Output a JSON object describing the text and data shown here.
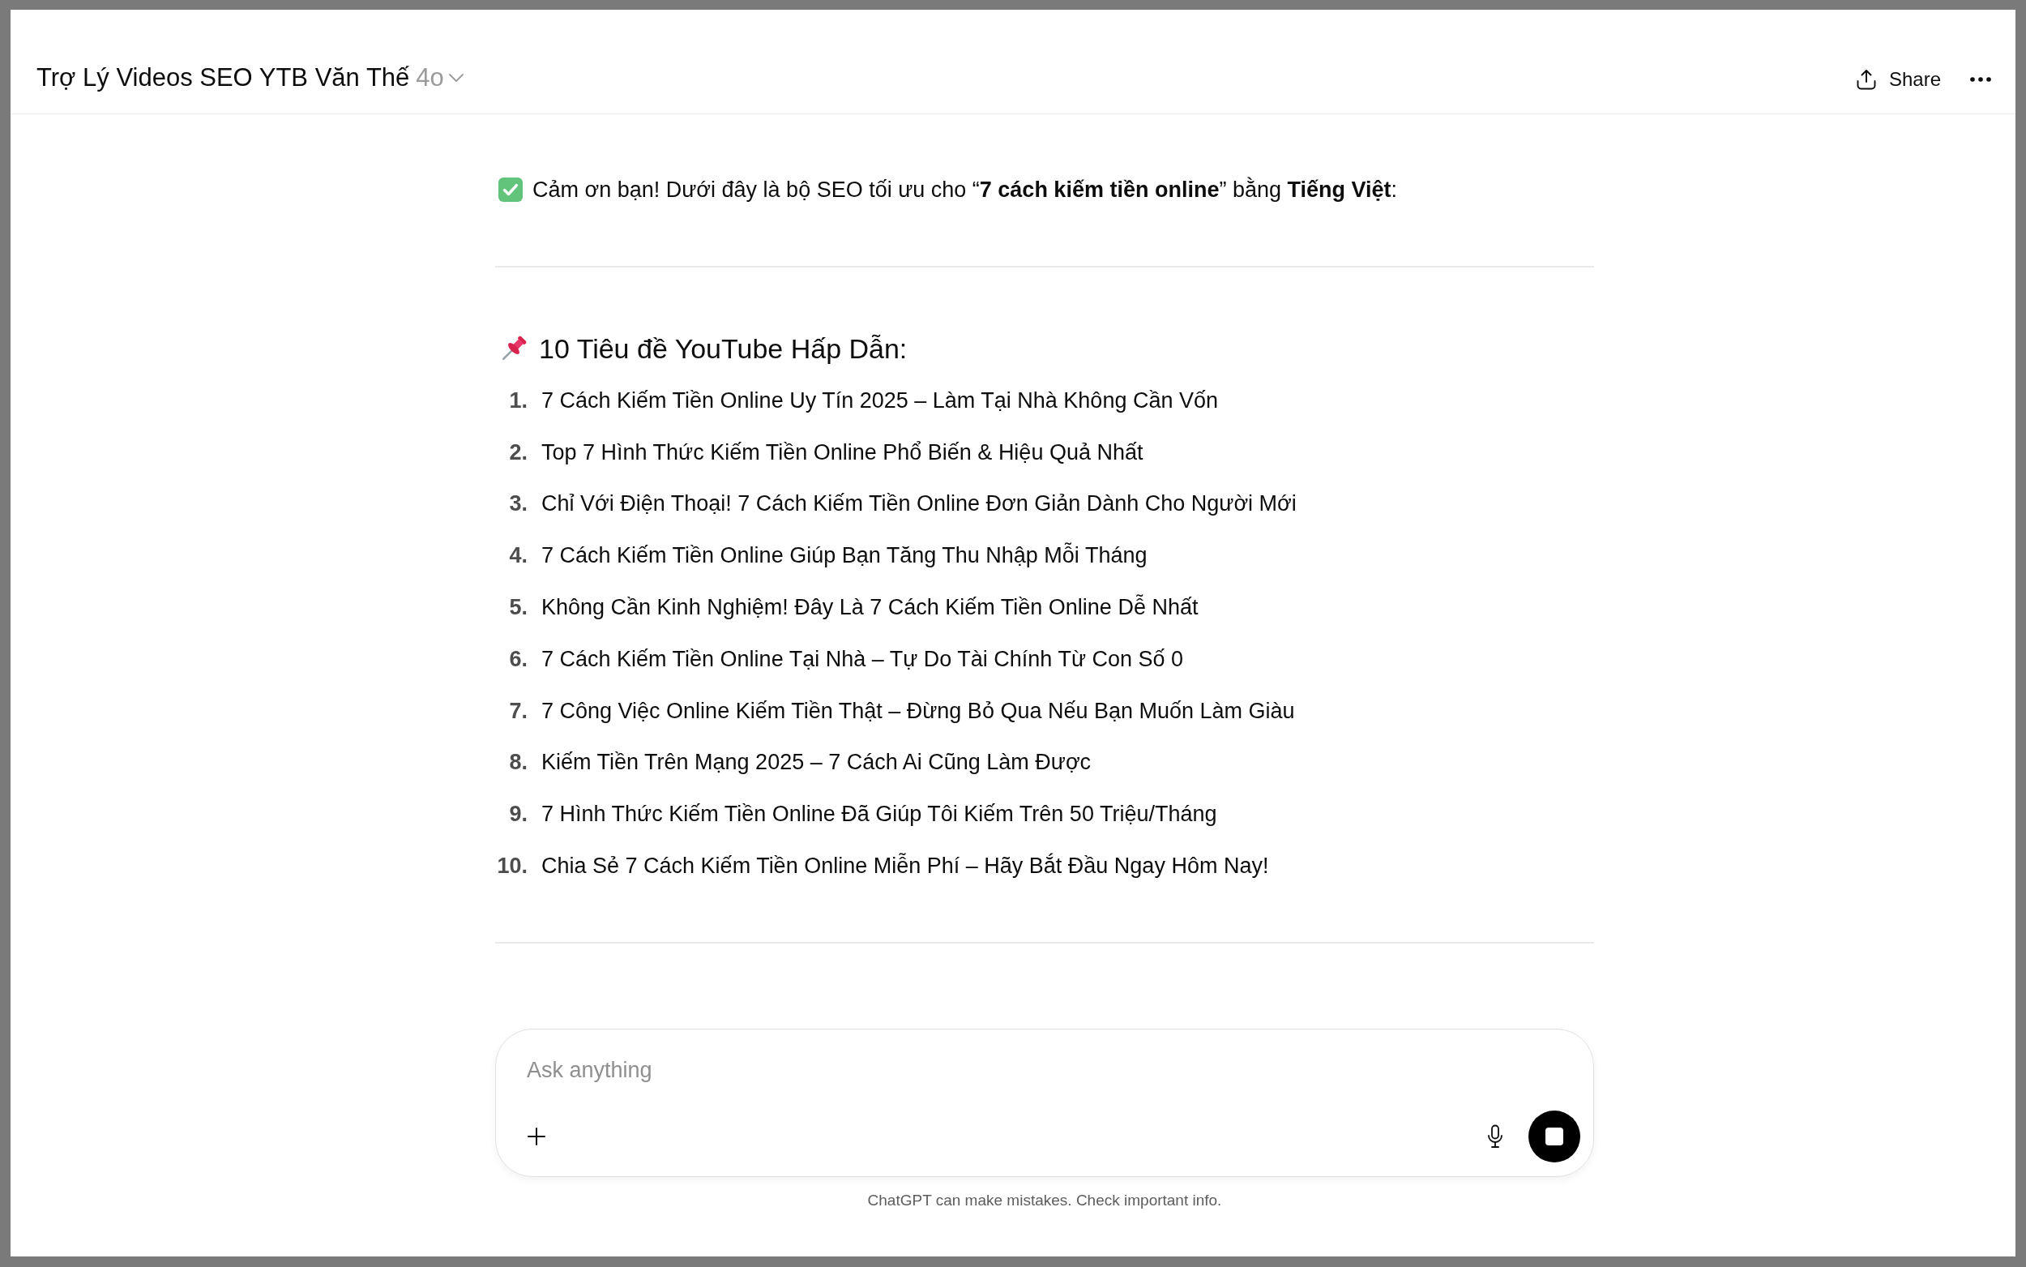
{
  "header": {
    "title": "Trợ Lý Videos SEO YTB Văn Thế",
    "model": "4o",
    "share_label": "Share"
  },
  "message": {
    "intro": "Cảm ơn bạn! Dưới đây là bộ SEO tối ưu cho “**7 cách kiếm tiền online**” bằng **Tiếng Việt**:",
    "heading": "10 Tiêu đề YouTube Hấp Dẫn:",
    "titles": [
      {
        "number": "1.",
        "text": "7 Cách Kiếm Tiền Online Uy Tín 2025 – Làm Tại Nhà Không Cần Vốn"
      },
      {
        "number": "2.",
        "text": "Top 7 Hình Thức Kiếm Tiền Online Phổ Biến & Hiệu Quả Nhất"
      },
      {
        "number": "3.",
        "text": "Chỉ Với Điện Thoại! 7 Cách Kiếm Tiền Online Đơn Giản Dành Cho Người Mới"
      },
      {
        "number": "4.",
        "text": "7 Cách Kiếm Tiền Online Giúp Bạn Tăng Thu Nhập Mỗi Tháng"
      },
      {
        "number": "5.",
        "text": "Không Cần Kinh Nghiệm! Đây Là 7 Cách Kiếm Tiền Online Dễ Nhất"
      },
      {
        "number": "6.",
        "text": "7 Cách Kiếm Tiền Online Tại Nhà – Tự Do Tài Chính Từ Con Số 0"
      },
      {
        "number": "7.",
        "text": "7 Công Việc Online Kiếm Tiền Thật – Đừng Bỏ Qua Nếu Bạn Muốn Làm Giàu"
      },
      {
        "number": "8.",
        "text": "Kiếm Tiền Trên Mạng 2025 – 7 Cách Ai Cũng Làm Được"
      },
      {
        "number": "9.",
        "text": "7 Hình Thức Kiếm Tiền Online Đã Giúp Tôi Kiếm Trên 50 Triệu/Tháng"
      },
      {
        "number": "10.",
        "text": "Chia Sẻ 7 Cách Kiếm Tiền Online Miễn Phí – Hãy Bắt Đầu Ngay Hôm Nay!"
      }
    ]
  },
  "composer": {
    "placeholder": "Ask anything"
  },
  "disclaimer": "ChatGPT can make mistakes. Check important info."
}
